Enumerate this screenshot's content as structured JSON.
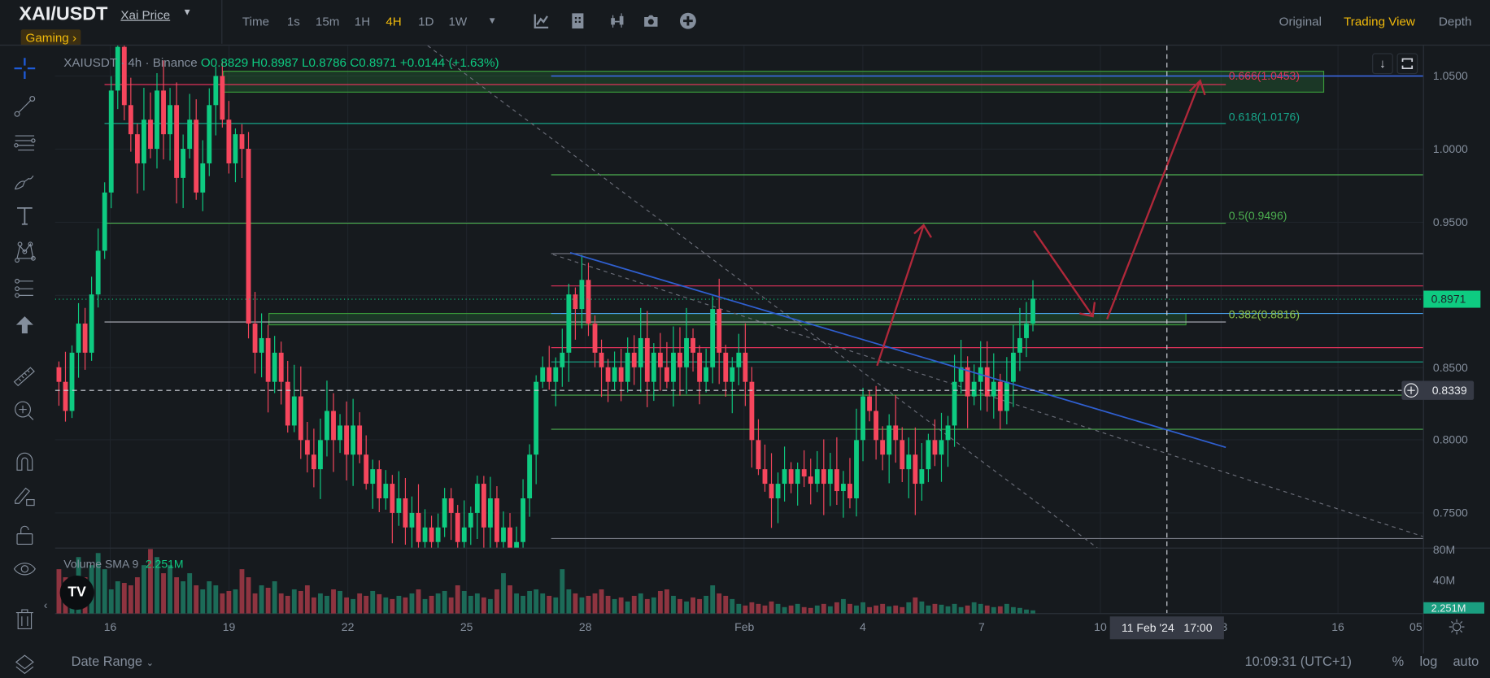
{
  "header": {
    "pair": "XAI/USDT",
    "subtitle": "Xai Price",
    "tag": "Gaming ›",
    "intervals": [
      "Time",
      "1s",
      "15m",
      "1H",
      "4H",
      "1D",
      "1W"
    ],
    "active_interval": "4H",
    "views": [
      "Original",
      "Trading View",
      "Depth"
    ],
    "active_view": "Trading View"
  },
  "legend": {
    "symbol": "XAIUSDT",
    "timeframe": "4h",
    "exchange": "Binance",
    "open": "O0.8829",
    "high": "H0.8987",
    "low": "L0.8786",
    "close": "C0.8971",
    "change": "+0.0144 (+1.63%)"
  },
  "fib_labels": {
    "f0666": "0.666(1.0453)",
    "f0618": "0.618(1.0176)",
    "f05": "0.5(0.9496)",
    "f0382": "0.382(0.8816)"
  },
  "price_axis": {
    "ticks": [
      "1.0500",
      "1.0000",
      "0.9500",
      "0.8500",
      "0.8000",
      "0.7500"
    ],
    "current_price": "0.8971",
    "crosshair_price": "0.8339"
  },
  "volume": {
    "label": "Volume SMA 9",
    "value": "2.251M",
    "axis_ticks": [
      "80M",
      "40M"
    ],
    "badge": "2.251M"
  },
  "time_axis": {
    "ticks": [
      "16",
      "19",
      "22",
      "25",
      "28",
      "Feb",
      "4",
      "7",
      "10",
      "13",
      "16",
      "05"
    ],
    "crosshair_time": "11 Feb '24   17:00"
  },
  "bottom_bar": {
    "date_range": "Date Range",
    "clock": "10:09:31 (UTC+1)",
    "percent": "%",
    "log": "log",
    "auto": "auto"
  },
  "colors": {
    "up": "#0ecb81",
    "down": "#f6465d",
    "accent": "#f0b90b"
  },
  "chart_data": {
    "type": "candlestick",
    "interval": "4h",
    "first_open": 0.85,
    "closes": [
      0.84,
      0.82,
      0.86,
      0.88,
      0.86,
      0.9,
      0.93,
      0.97,
      1.04,
      1.07,
      1.03,
      1.01,
      0.99,
      1.02,
      1.0,
      1.04,
      1.01,
      1.03,
      0.98,
      1.0,
      1.02,
      0.97,
      0.99,
      1.03,
      1.05,
      1.02,
      0.99,
      1.01,
      1.0,
      0.88,
      0.86,
      0.87,
      0.84,
      0.86,
      0.84,
      0.81,
      0.83,
      0.8,
      0.79,
      0.78,
      0.8,
      0.82,
      0.8,
      0.81,
      0.79,
      0.81,
      0.79,
      0.77,
      0.78,
      0.76,
      0.77,
      0.75,
      0.76,
      0.74,
      0.75,
      0.73,
      0.74,
      0.73,
      0.74,
      0.76,
      0.75,
      0.73,
      0.74,
      0.75,
      0.77,
      0.74,
      0.76,
      0.73,
      0.74,
      0.72,
      0.73,
      0.76,
      0.79,
      0.84,
      0.85,
      0.84,
      0.85,
      0.86,
      0.9,
      0.89,
      0.91,
      0.88,
      0.86,
      0.85,
      0.84,
      0.85,
      0.84,
      0.86,
      0.85,
      0.87,
      0.84,
      0.86,
      0.85,
      0.84,
      0.86,
      0.85,
      0.87,
      0.86,
      0.84,
      0.85,
      0.89,
      0.86,
      0.84,
      0.85,
      0.86,
      0.84,
      0.8,
      0.78,
      0.77,
      0.76,
      0.77,
      0.78,
      0.77,
      0.78,
      0.775,
      0.77,
      0.78,
      0.77,
      0.78,
      0.765,
      0.77,
      0.76,
      0.8,
      0.83,
      0.82,
      0.8,
      0.79,
      0.81,
      0.8,
      0.78,
      0.79,
      0.77,
      0.78,
      0.8,
      0.79,
      0.8,
      0.81,
      0.84,
      0.85,
      0.83,
      0.84,
      0.85,
      0.83,
      0.84,
      0.82,
      0.84,
      0.86,
      0.87,
      0.88,
      0.8971
    ],
    "volumes_m": [
      55,
      45,
      40,
      70,
      45,
      60,
      75,
      55,
      30,
      40,
      38,
      35,
      45,
      60,
      95,
      70,
      50,
      60,
      45,
      40,
      50,
      35,
      30,
      40,
      35,
      25,
      28,
      30,
      55,
      45,
      25,
      35,
      32,
      40,
      25,
      22,
      30,
      28,
      35,
      20,
      25,
      22,
      30,
      28,
      20,
      18,
      25,
      22,
      28,
      24,
      20,
      18,
      22,
      20,
      25,
      30,
      18,
      22,
      25,
      28,
      20,
      35,
      28,
      22,
      25,
      20,
      18,
      30,
      50,
      35,
      25,
      22,
      28,
      30,
      25,
      22,
      20,
      55,
      30,
      25,
      20,
      22,
      25,
      30,
      22,
      18,
      20,
      15,
      22,
      25,
      18,
      20,
      28,
      30,
      22,
      18,
      15,
      20,
      18,
      22,
      35,
      25,
      22,
      18,
      12,
      10,
      14,
      12,
      10,
      15,
      12,
      8,
      10,
      12,
      8,
      7,
      10,
      12,
      9,
      14,
      18,
      12,
      10,
      14,
      8,
      10,
      12,
      9,
      10,
      8,
      14,
      20,
      15,
      10,
      12,
      11,
      9,
      12,
      8,
      10,
      14,
      12,
      10,
      8,
      9,
      12,
      8,
      7,
      5,
      4
    ],
    "price_range": [
      0.726,
      1.07
    ]
  }
}
